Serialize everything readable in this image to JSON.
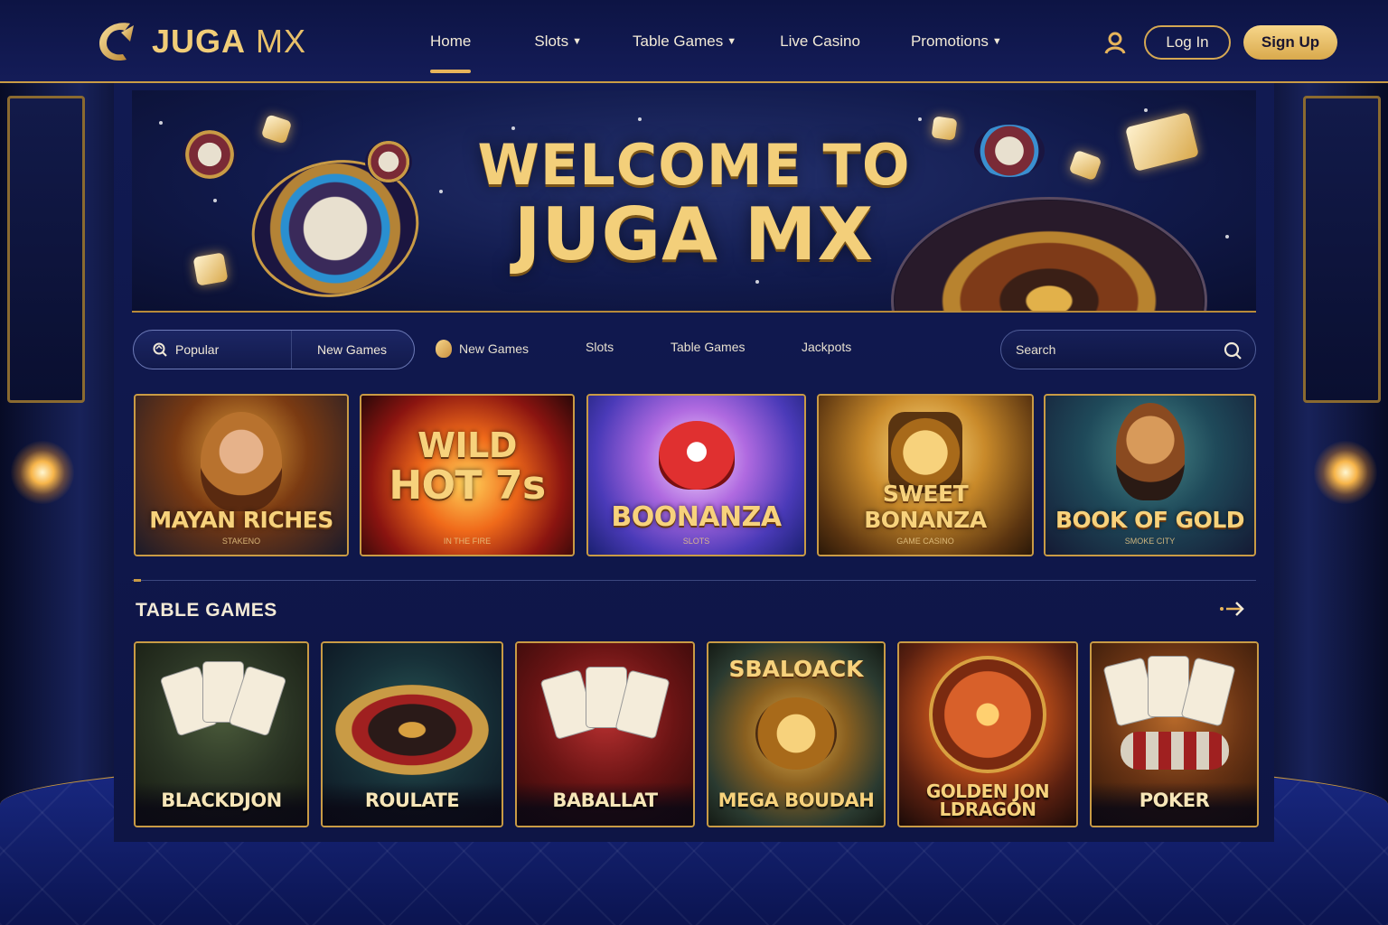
{
  "brand": {
    "name": "JUGA",
    "suffix": " MX",
    "accent": "#e7b45b",
    "navy": "#111a52"
  },
  "nav": {
    "items": [
      {
        "label": "Home",
        "active": true
      },
      {
        "label": "Slots",
        "dropdown": true
      },
      {
        "label": "Table Games",
        "dropdown": true
      },
      {
        "label": "Live Casino"
      },
      {
        "label": "Promotions",
        "dropdown": true
      }
    ],
    "user_icon": "user-icon",
    "login_label": "Log In",
    "signup_label": "Sign Up"
  },
  "hero": {
    "line1": "WELCOME TO",
    "line2": "JUGA MX"
  },
  "filters": {
    "popular_label": "Popular",
    "new_games_label": "New Games",
    "tabs": [
      "New Games",
      "Slots",
      "Table Games",
      "Jackpots"
    ],
    "search_placeholder": "Search"
  },
  "slots": [
    {
      "title": "MAYAN RICHES",
      "sub": "STAKENO",
      "theme": "amber"
    },
    {
      "title_l1": "WILD",
      "title_l2": "HOT 7s",
      "sub": "IN THE FIRE",
      "theme": "fire"
    },
    {
      "title": "BOONANZA",
      "sub": "SLOTS",
      "theme": "candy"
    },
    {
      "title": "SWEET BONANZA",
      "sub": "GAME CASINO",
      "theme": "gold"
    },
    {
      "title": "BOOK OF GOLD",
      "sub": "SMOKE CITY",
      "theme": "teal"
    }
  ],
  "table_section": {
    "title": "TABLE GAMES",
    "arrow_icon": "arrow-right-icon"
  },
  "table_games": [
    {
      "title": "BLACKDJON"
    },
    {
      "title": "ROULATE"
    },
    {
      "title": "BABALLAT"
    },
    {
      "title": "MEGA BOUDAH",
      "top_title": "SBALOACK"
    },
    {
      "title": "GOLDEN JON LDRAGON"
    },
    {
      "title": "POKER"
    }
  ]
}
